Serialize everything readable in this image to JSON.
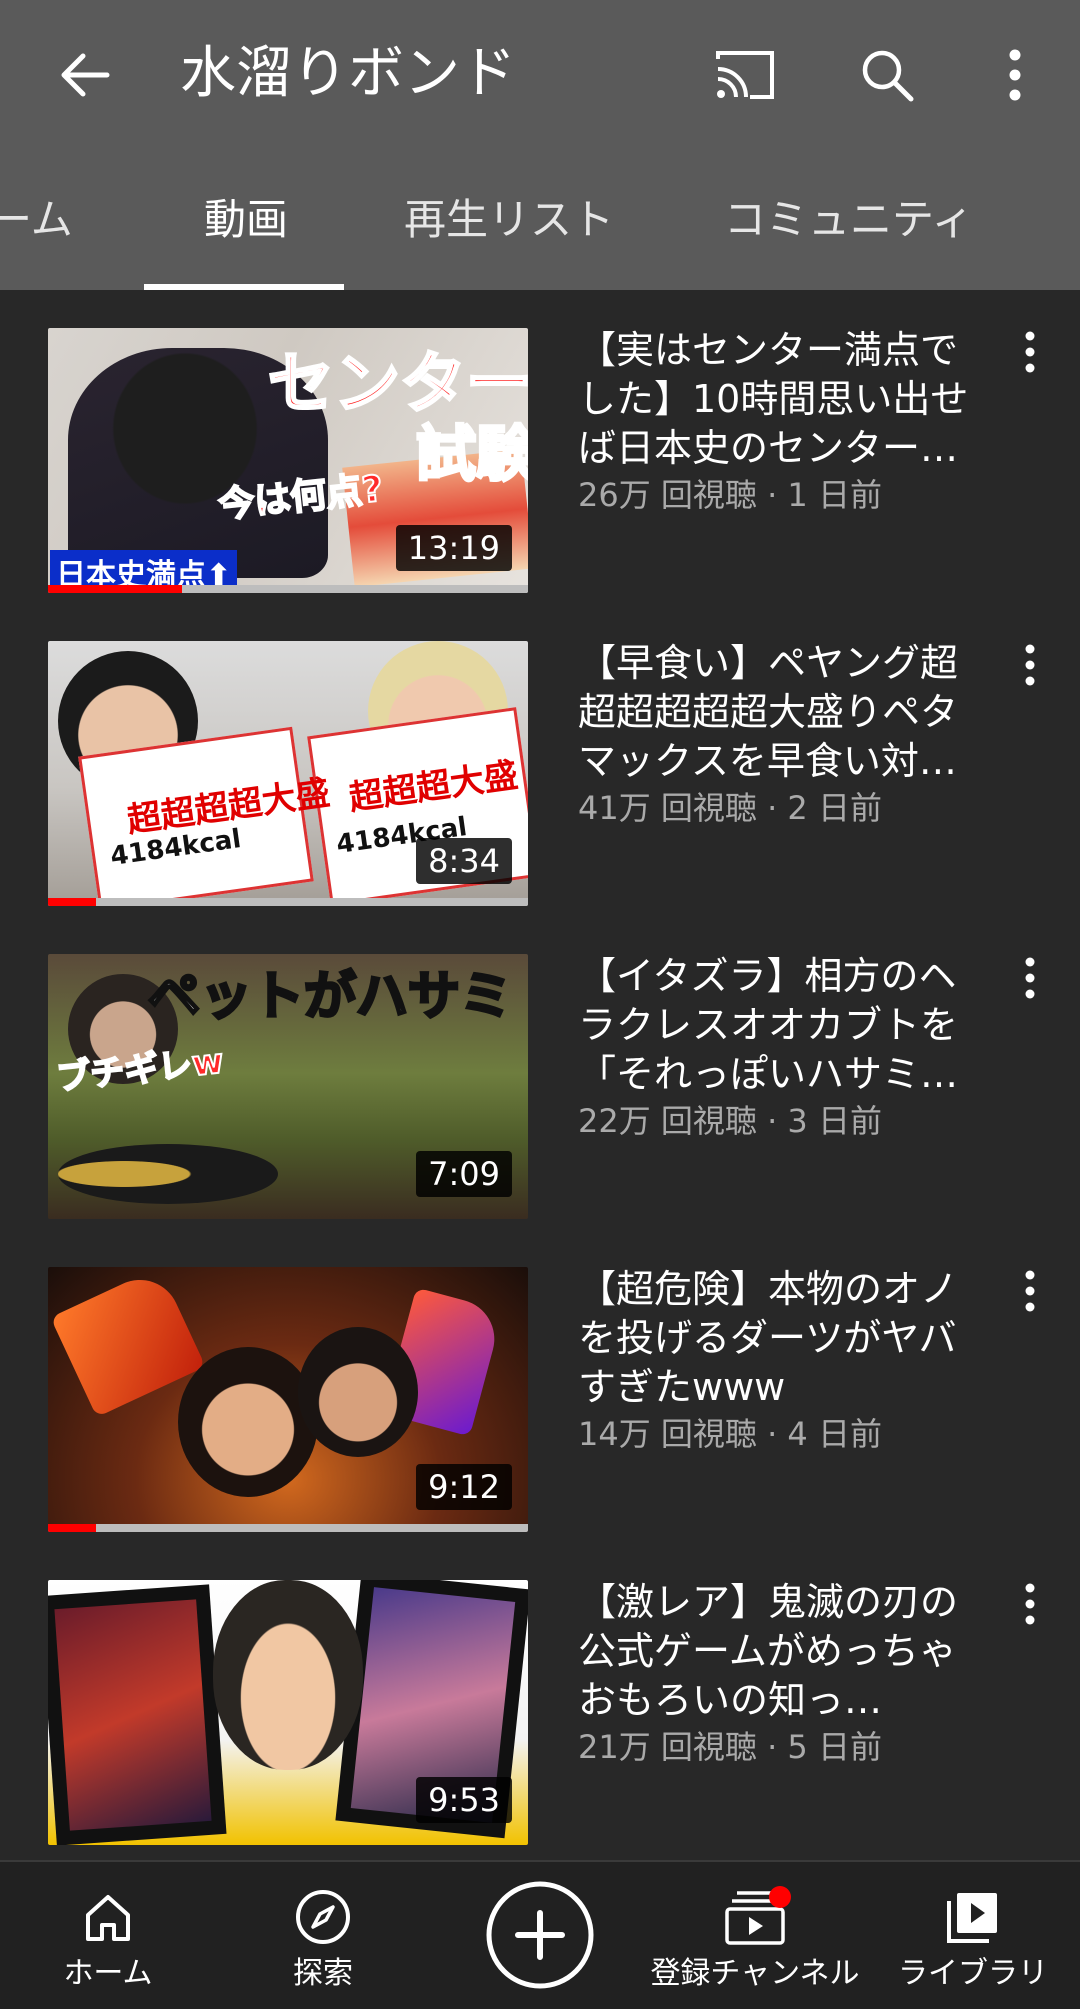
{
  "header": {
    "title": "水溜りボンド",
    "icons": {
      "back": "arrow-back-icon",
      "cast": "cast-icon",
      "search": "search-icon",
      "more": "more-vert-icon"
    }
  },
  "tabs": [
    {
      "label": "ホーム"
    },
    {
      "label": "動画",
      "active": true
    },
    {
      "label": "再生リスト"
    },
    {
      "label": "コミュニティ"
    }
  ],
  "videos": [
    {
      "title": "【実はセンター満点でした】10時間思い出せば日本史のセンター…",
      "meta": "26万 回視聴 · 1 日前",
      "duration": "13:19",
      "progress": 0.28,
      "thumb_texts": [
        "センター",
        "試験",
        "今は何点?",
        "日本史満点⬆"
      ]
    },
    {
      "title": "【早食い】ペヤング超超超超超超大盛りペタマックスを早食い対…",
      "meta": "41万 回視聴 · 2 日前",
      "duration": "8:34",
      "progress": 0.1,
      "thumb_texts": [
        "超超超超大盛",
        "4184kcal",
        "超超超大盛",
        "4184kcal"
      ]
    },
    {
      "title": "【イタズラ】相方のヘラクレスオオカブトを「それっぽいハサミ…",
      "meta": "22万 回視聴 · 3 日前",
      "duration": "7:09",
      "progress": 0,
      "thumb_texts": [
        "ペットがハサミ",
        "ブチギレw"
      ]
    },
    {
      "title": "【超危険】本物のオノを投げるダーツがヤバすぎたwww",
      "meta": "14万 回視聴 · 4 日前",
      "duration": "9:12",
      "progress": 0.1,
      "thumb_texts": []
    },
    {
      "title": "【激レア】鬼滅の刃の公式ゲームがめっちゃおもろいの知っ…",
      "meta": "21万 回視聴 · 5 日前",
      "duration": "9:53",
      "progress": 0,
      "thumb_texts": []
    }
  ],
  "bottom_nav": [
    {
      "label": "ホーム",
      "icon": "home-icon"
    },
    {
      "label": "探索",
      "icon": "explore-icon"
    },
    {
      "label": "",
      "icon": "create-plus-icon"
    },
    {
      "label": "登録チャンネル",
      "icon": "subscriptions-icon",
      "badge": true
    },
    {
      "label": "ライブラリ",
      "icon": "library-icon"
    }
  ],
  "colors": {
    "header_bg": "#5a5a5a",
    "body_bg": "#282828",
    "accent": "#ff0000"
  }
}
